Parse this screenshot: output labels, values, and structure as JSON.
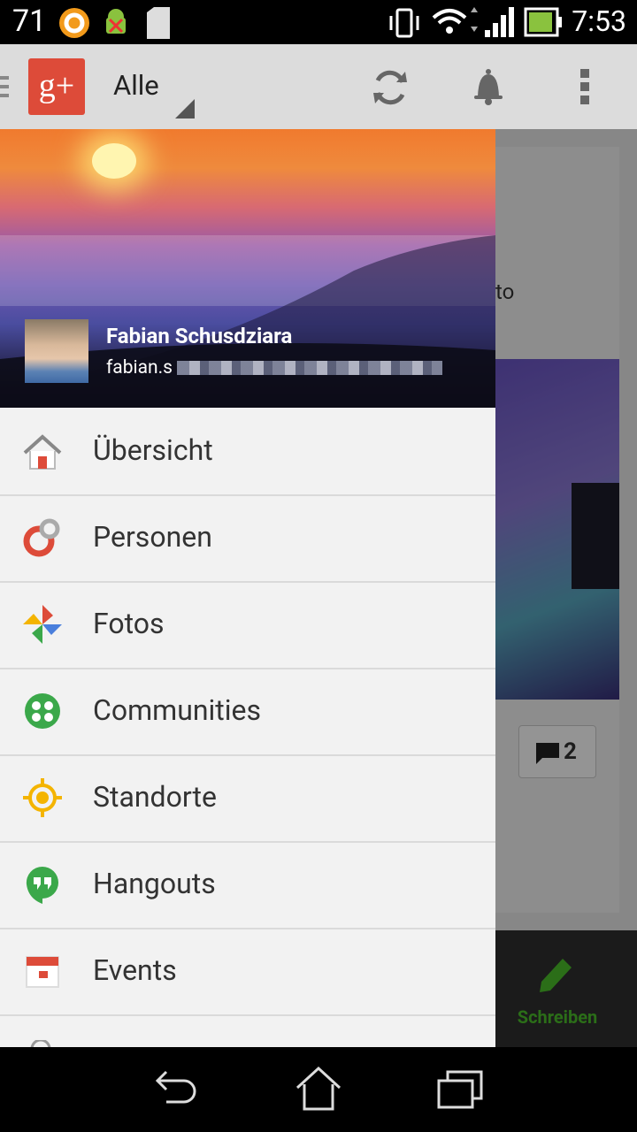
{
  "status_bar": {
    "left_number": "71",
    "time": "7:53"
  },
  "app_bar": {
    "logo_text": "g+",
    "stream_selector": "Alle"
  },
  "drawer": {
    "profile": {
      "name": "Fabian Schusdziara",
      "email_visible": "fabian.s"
    },
    "menu": [
      {
        "label": "Übersicht",
        "icon": "home-icon"
      },
      {
        "label": "Personen",
        "icon": "people-circles-icon"
      },
      {
        "label": "Fotos",
        "icon": "photos-pinwheel-icon"
      },
      {
        "label": "Communities",
        "icon": "communities-icon"
      },
      {
        "label": "Standorte",
        "icon": "location-target-icon"
      },
      {
        "label": "Hangouts",
        "icon": "hangouts-quote-icon"
      },
      {
        "label": "Events",
        "icon": "calendar-icon"
      }
    ]
  },
  "background_content": {
    "partial_text": "to",
    "comment_count": "2",
    "compose_label": "Schreiben"
  },
  "colors": {
    "gplus_red": "#dd4b39",
    "drawer_bg": "#f2f2f2",
    "compose_green": "#2b6e18"
  }
}
